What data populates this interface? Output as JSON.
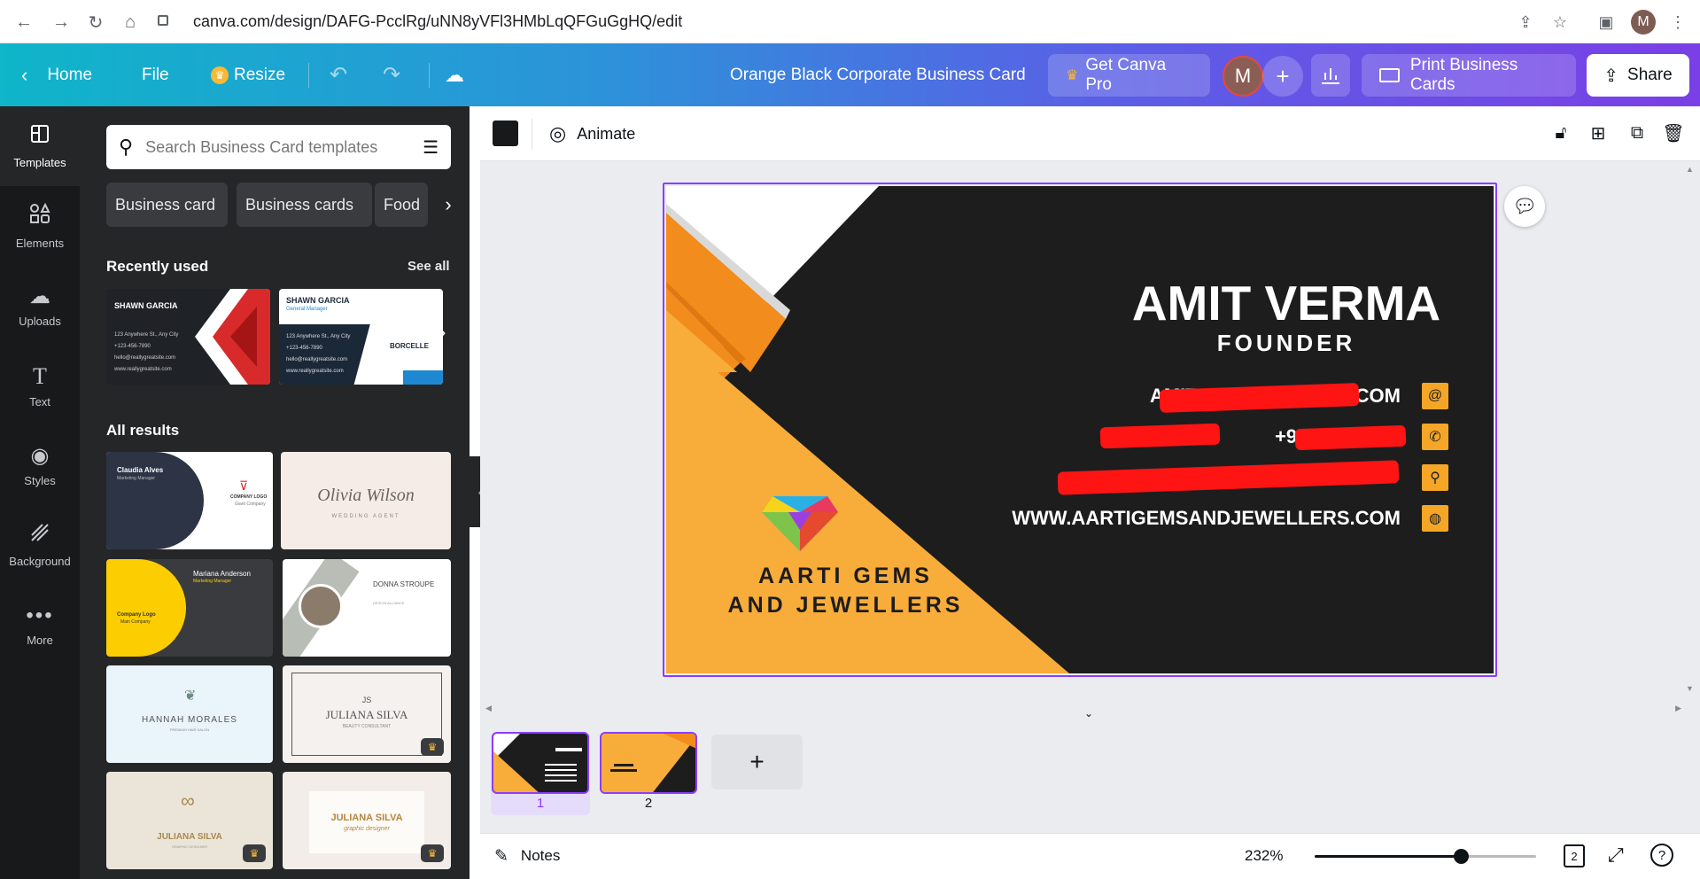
{
  "browser": {
    "url": "canva.com/design/DAFG-PcclRg/uNN8yVFl3HMbLqQFGuGgHQ/edit"
  },
  "topbar": {
    "home_label": "Home",
    "file_label": "File",
    "resize_label": "Resize",
    "doc_title": "Orange Black Corporate Business Card",
    "get_pro_label": "Get Canva Pro",
    "avatar_letter": "M",
    "print_label": "Print Business Cards",
    "share_label": "Share"
  },
  "rail": {
    "items": [
      {
        "label": "Templates",
        "icon": "templates-icon"
      },
      {
        "label": "Elements",
        "icon": "elements-icon"
      },
      {
        "label": "Uploads",
        "icon": "uploads-icon"
      },
      {
        "label": "Text",
        "icon": "text-icon"
      },
      {
        "label": "Styles",
        "icon": "styles-icon"
      },
      {
        "label": "Background",
        "icon": "background-icon"
      },
      {
        "label": "More",
        "icon": "more-icon"
      }
    ]
  },
  "panel": {
    "search_placeholder": "Search Business Card templates",
    "chips": [
      "Business card",
      "Business cards",
      "Food"
    ],
    "recently_used": "Recently used",
    "see_all": "See all",
    "all_results": "All results",
    "recent": [
      {
        "name": "SHAWN GARCIA",
        "lines": [
          "123 Anywhere St., Any City",
          "+123-456-7890",
          "hello@reallygreatsite.com",
          "www.reallygreatsite.com"
        ]
      },
      {
        "name": "SHAWN GARCIA",
        "role": "General Manager",
        "brand": "BORCELLE",
        "lines": [
          "123 Anywhere St., Any City",
          "+123-456-7890",
          "hello@reallygreatsite.com",
          "www.reallygreatsite.com"
        ]
      }
    ],
    "results": [
      {
        "name": "Claudia Alves",
        "role": "Marketing Manager",
        "logo": "COMPANY LOGO",
        "sub": "Giant Company"
      },
      {
        "name": "Olivia Wilson",
        "sub": "WEDDING AGENT"
      },
      {
        "name": "Mariana Anderson",
        "role": "Marketing Manager",
        "logo": "Company Logo",
        "sub": "Main Company"
      },
      {
        "name": "DONNA STROUPE",
        "role": "DESIGN ALLIANCE"
      },
      {
        "name": "HANNAH MORALES",
        "sub": "PREMIUM HAIR SALON"
      },
      {
        "name": "JULIANA SILVA",
        "mono": "JS",
        "sub": "BEAUTY CONSULTANT"
      },
      {
        "name": "JULIANA SILVA",
        "sub": "GRAPHIC DESIGNER"
      },
      {
        "name": "JULIANA SILVA",
        "sub": "graphic designer"
      }
    ]
  },
  "editbar": {
    "animate_label": "Animate",
    "fill_color": "#18191b"
  },
  "card": {
    "name": "AMIT VERMA",
    "title": "FOUNDER",
    "company_line1": "AARTI GEMS",
    "company_line2": "AND JEWELLERS",
    "email": "AMITVERMA@GMAIL.COM",
    "phone": "+9195 , +9195",
    "address": "",
    "website": "WWW.AARTIGEMSANDJEWELLERS.COM",
    "accent": "#f6a626",
    "dark": "#1d1d1e"
  },
  "pages": {
    "items": [
      {
        "number": "1"
      },
      {
        "number": "2"
      }
    ]
  },
  "bottom": {
    "notes_label": "Notes",
    "zoom": "232%",
    "zoom_fraction": 0.66,
    "page_count": "2"
  }
}
